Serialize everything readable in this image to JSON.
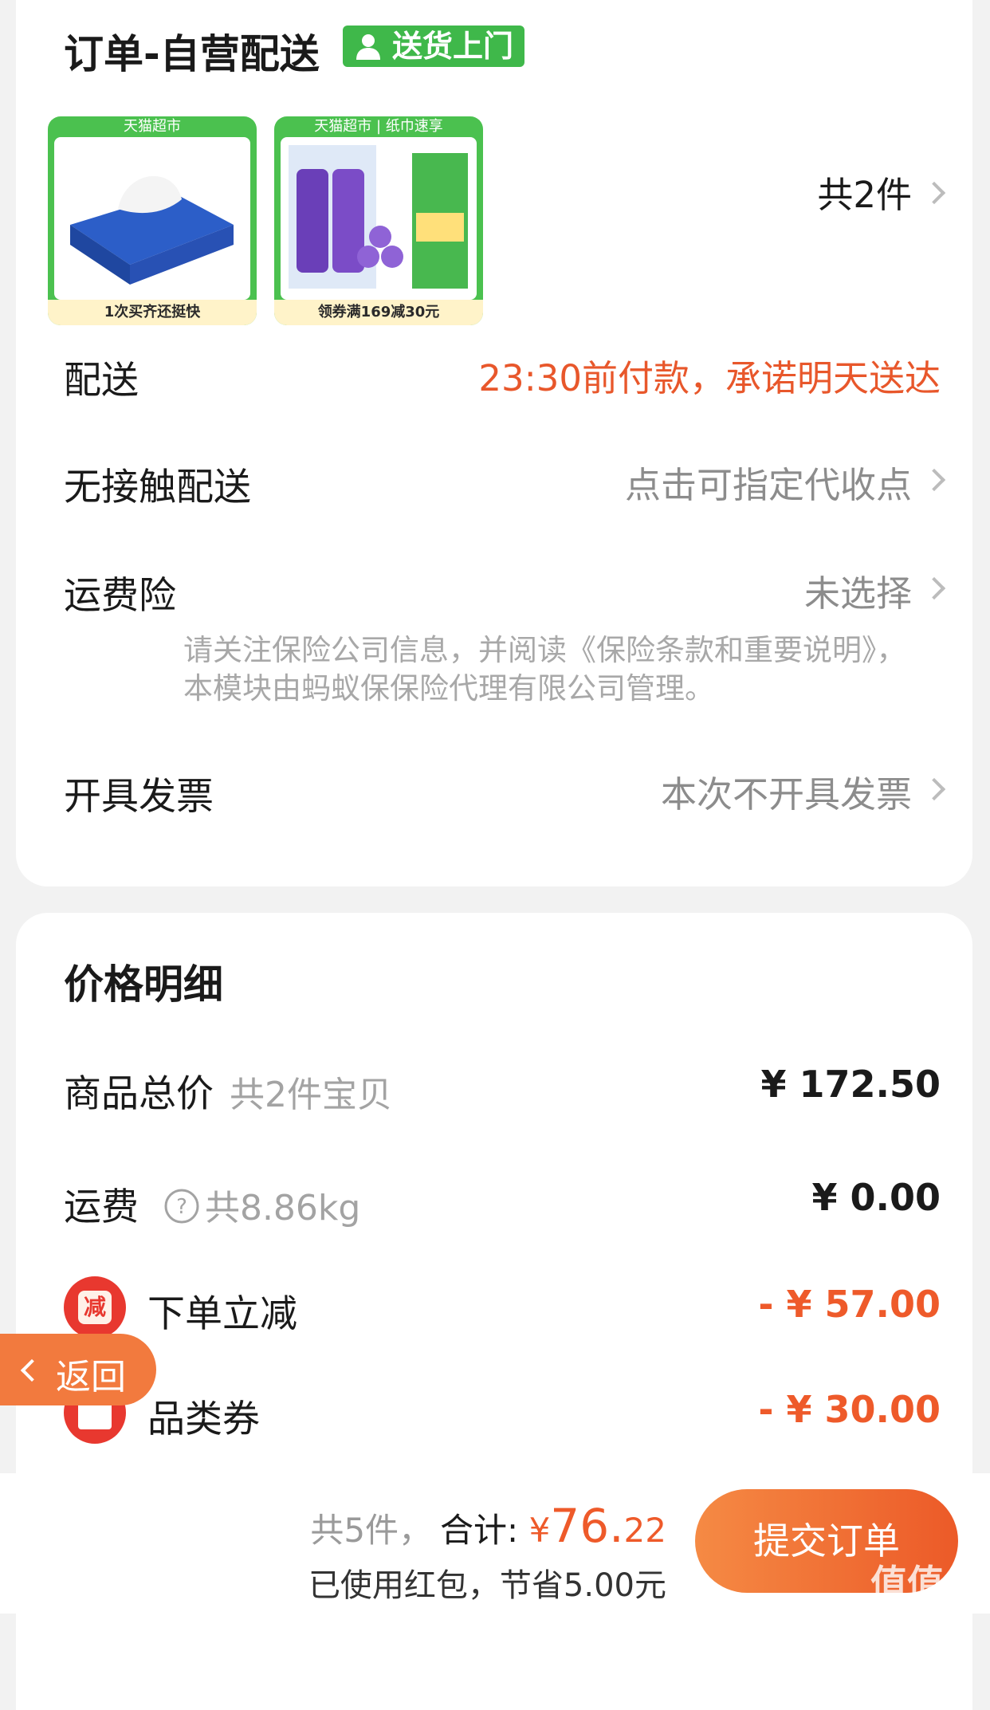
{
  "order": {
    "title": "订单-自营配送",
    "delivery_badge": "送货上门",
    "products": [
      {
        "store_label": "天猫超市",
        "caption": "1次买齐还挺快"
      },
      {
        "store_label": "天猫超市 | 纸巾速享",
        "caption": "领券满169减30元"
      }
    ],
    "item_count": "共2件",
    "delivery": {
      "label": "配送",
      "value": "23:30前付款，承诺明天送达"
    },
    "contactless": {
      "label": "无接触配送",
      "value": "点击可指定代收点"
    },
    "insurance": {
      "label": "运费险",
      "value": "未选择",
      "note": "请关注保险公司信息，并阅读《保险条款和重要说明》，本模块由蚂蚁保保险代理有限公司管理。"
    },
    "invoice": {
      "label": "开具发票",
      "value": "本次不开具发票"
    }
  },
  "price": {
    "title": "价格明细",
    "goods_total": {
      "label": "商品总价",
      "note": "共2件宝贝",
      "amount": "¥ 172.50"
    },
    "shipping": {
      "label": "运费",
      "note": "共8.86kg",
      "amount": "¥ 0.00"
    },
    "instant_discount": {
      "label": "下单立减",
      "icon_text": "减",
      "amount": "- ¥ 57.00"
    },
    "category_coupon": {
      "label": "品类券",
      "amount": "- ¥ 30.00"
    }
  },
  "back": {
    "label": "返回"
  },
  "footer": {
    "count": "共5件，",
    "total_label": "合计:",
    "currency": "¥",
    "total_int": "76.",
    "total_dec": "22",
    "savings": "已使用红包，节省5.00元",
    "submit_label": "提交订单",
    "watermark": "值值值"
  },
  "colors": {
    "accent": "#ee5a2a",
    "green": "#3fb84a"
  }
}
